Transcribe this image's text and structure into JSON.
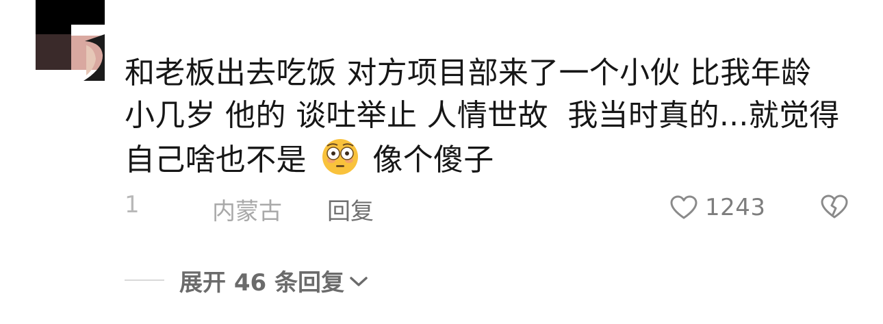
{
  "comment": {
    "text_line_1": "和老板出去吃饭 对方项目部来了一个小伙 比我年龄",
    "text_line_2": "小几岁 他的 谈吐举止 人情世故  我当时真的...就觉得",
    "text_line_3a": "自己啥也不是",
    "emoji_name": "flushed-face-icon",
    "text_line_3b": "像个傻子"
  },
  "meta": {
    "time": "1",
    "location": "内蒙古",
    "reply_label": "回复",
    "like_count": "1243"
  },
  "replies": {
    "expand_label": "展开 46 条回复"
  },
  "colors": {
    "text": "#161616",
    "muted": "#a9a9a9",
    "icon": "#8a8a8a",
    "emoji_face": "#f9c23c"
  }
}
